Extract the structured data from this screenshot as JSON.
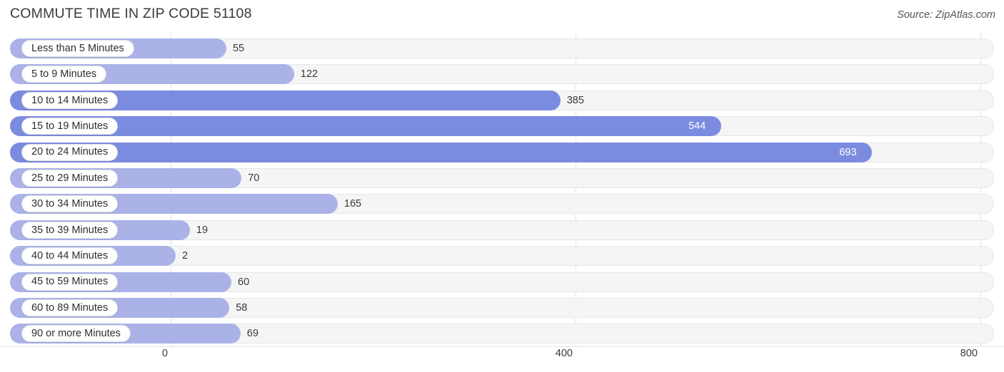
{
  "header": {
    "title": "COMMUTE TIME IN ZIP CODE 51108",
    "source": "Source: ZipAtlas.com"
  },
  "chart_data": {
    "type": "bar",
    "orientation": "horizontal",
    "title": "COMMUTE TIME IN ZIP CODE 51108",
    "xlabel": "",
    "ylabel": "",
    "xlim": [
      0,
      800
    ],
    "xticks": [
      0,
      400,
      800
    ],
    "xtick_labels": [
      "0",
      "400",
      "800"
    ],
    "grid": true,
    "legend": "none",
    "categories": [
      "Less than 5 Minutes",
      "5 to 9 Minutes",
      "10 to 14 Minutes",
      "15 to 19 Minutes",
      "20 to 24 Minutes",
      "25 to 29 Minutes",
      "30 to 34 Minutes",
      "35 to 39 Minutes",
      "40 to 44 Minutes",
      "45 to 59 Minutes",
      "60 to 89 Minutes",
      "90 or more Minutes"
    ],
    "values": [
      55,
      122,
      385,
      544,
      693,
      70,
      165,
      19,
      2,
      60,
      58,
      69
    ],
    "value_labels": [
      "55",
      "122",
      "385",
      "544",
      "693",
      "70",
      "165",
      "19",
      "2",
      "60",
      "58",
      "69"
    ],
    "colors": {
      "bar_light": "#aab2e8",
      "bar_dark": "#7b8ce0",
      "track": "#f5f5f6",
      "track_border": "#e6e6e8",
      "gridline": "#e3e3e6",
      "label_pill_bg": "#ffffff",
      "value_text": "#3a3a3a",
      "value_text_inside": "#ffffff",
      "title_text": "#3a3a3a"
    },
    "bar_shades": [
      "light",
      "light",
      "dark",
      "dark",
      "dark",
      "light",
      "light",
      "light",
      "light",
      "light",
      "light",
      "light"
    ],
    "value_label_placement": [
      "outside",
      "outside",
      "outside",
      "inside",
      "inside",
      "outside",
      "outside",
      "outside",
      "outside",
      "outside",
      "outside",
      "outside"
    ]
  }
}
